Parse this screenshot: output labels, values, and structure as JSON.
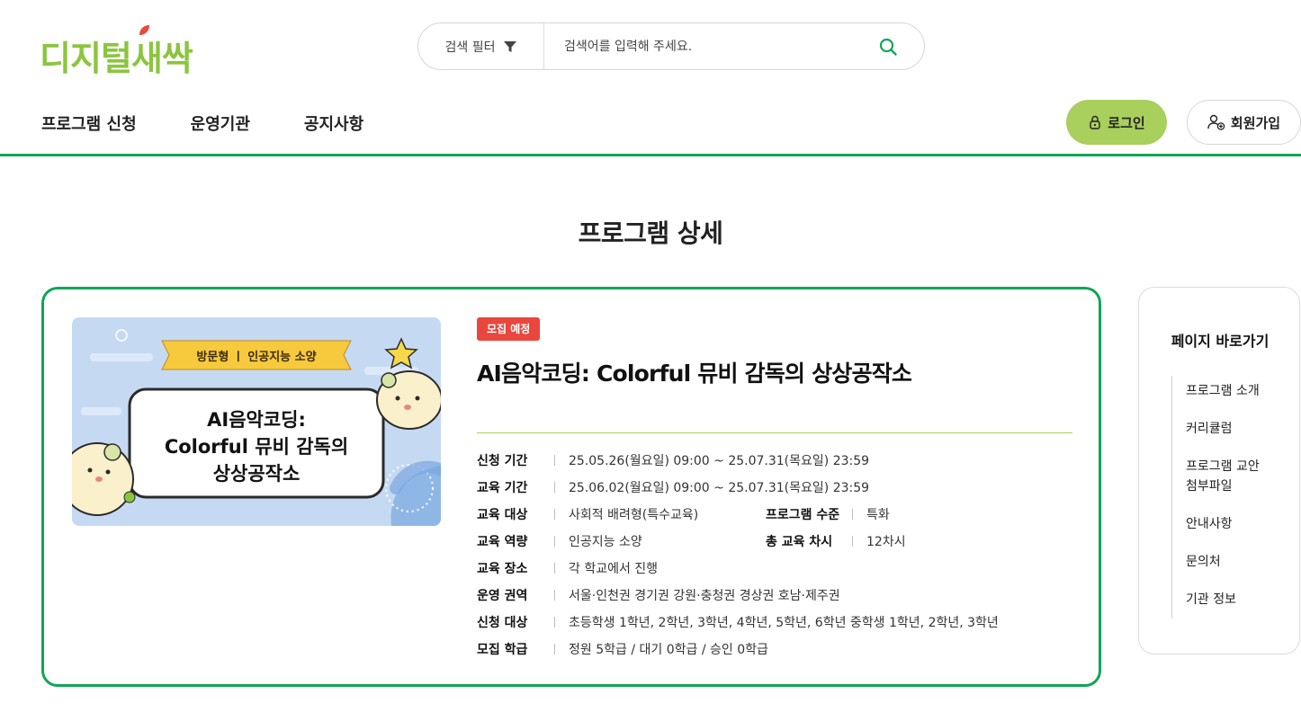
{
  "logo": {
    "text": "디지털새싹"
  },
  "search": {
    "filter_label": "검색 필터",
    "placeholder": "검색어를 입력해 주세요."
  },
  "nav": {
    "items": [
      "프로그램 신청",
      "운영기관",
      "공지사항"
    ]
  },
  "auth": {
    "login_label": "로그인",
    "signup_label": "회원가입"
  },
  "page": {
    "title": "프로그램 상세"
  },
  "thumbnail": {
    "tag": "방문형 ㅣ 인공지능 소양",
    "line1": "AI음악코딩:",
    "line2": "Colorful 뮤비 감독의",
    "line3": "상상공작소"
  },
  "program": {
    "status_badge": "모집 예정",
    "title": "AI음악코딩: Colorful 뮤비 감독의 상상공작소",
    "apply_period_label": "신청 기간",
    "apply_period": "25.05.26(월요일) 09:00 ~ 25.07.31(목요일) 23:59",
    "edu_period_label": "교육 기간",
    "edu_period": "25.06.02(월요일) 09:00 ~ 25.07.31(목요일) 23:59",
    "target_label": "교육 대상",
    "target": "사회적 배려형(특수교육)",
    "level_label": "프로그램 수준",
    "level": "특화",
    "competency_label": "교육 역량",
    "competency": "인공지능 소양",
    "sessions_label": "총 교육 차시",
    "sessions": "12차시",
    "place_label": "교육 장소",
    "place": "각 학교에서 진행",
    "region_label": "운영 권역",
    "region": "서울·인천권 경기권 강원·충청권 경상권 호남·제주권",
    "eligible_label": "신청 대상",
    "eligible": "초등학생 1학년, 2학년, 3학년, 4학년, 5학년, 6학년 중학생 1학년, 2학년, 3학년",
    "classes_label": "모집 학급",
    "classes": "정원 5학급 / 대기 0학급 / 승인 0학급"
  },
  "side_nav": {
    "title": "페이지 바로가기",
    "items": [
      "프로그램 소개",
      "커리큘럼",
      "프로그램 교안 첨부파일",
      "안내사항",
      "문의처",
      "기관 정보"
    ]
  },
  "colors": {
    "brand_green": "#12a556",
    "accent_lime": "#a9cf5d",
    "badge_red": "#e9463d"
  }
}
